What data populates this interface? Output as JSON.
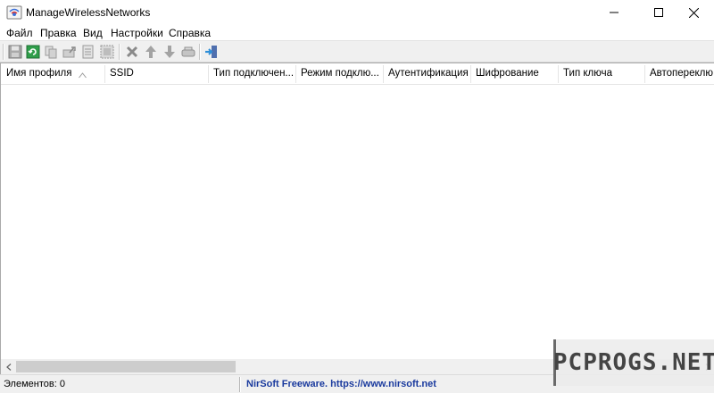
{
  "window": {
    "title": "ManageWirelessNetworks",
    "controls": [
      "minimize-icon",
      "maximize-icon",
      "close-icon"
    ]
  },
  "menu": {
    "items": [
      "Файл",
      "Правка",
      "Вид",
      "Настройки",
      "Справка"
    ]
  },
  "toolbar": {
    "buttons": [
      "save-icon",
      "refresh-icon",
      "copy-icon",
      "export-icon",
      "properties-icon",
      "select-icon",
      "delete-icon",
      "move-up-icon",
      "move-down-icon",
      "connect-icon",
      "exit-icon"
    ]
  },
  "list": {
    "columns": [
      "Имя профиля",
      "SSID",
      "Тип подключен...",
      "Режим подклю...",
      "Аутентификация",
      "Шифрование",
      "Тип ключа",
      "Автопереклю..."
    ],
    "rows": []
  },
  "status": {
    "count": "Элементов: 0",
    "link": "NirSoft Freeware. https://www.nirsoft.net"
  },
  "watermark": {
    "text": "PCPROGS.NET"
  },
  "colors": {
    "link": "#1a3a9e",
    "toolbar_bg": "#f0f0f0"
  }
}
